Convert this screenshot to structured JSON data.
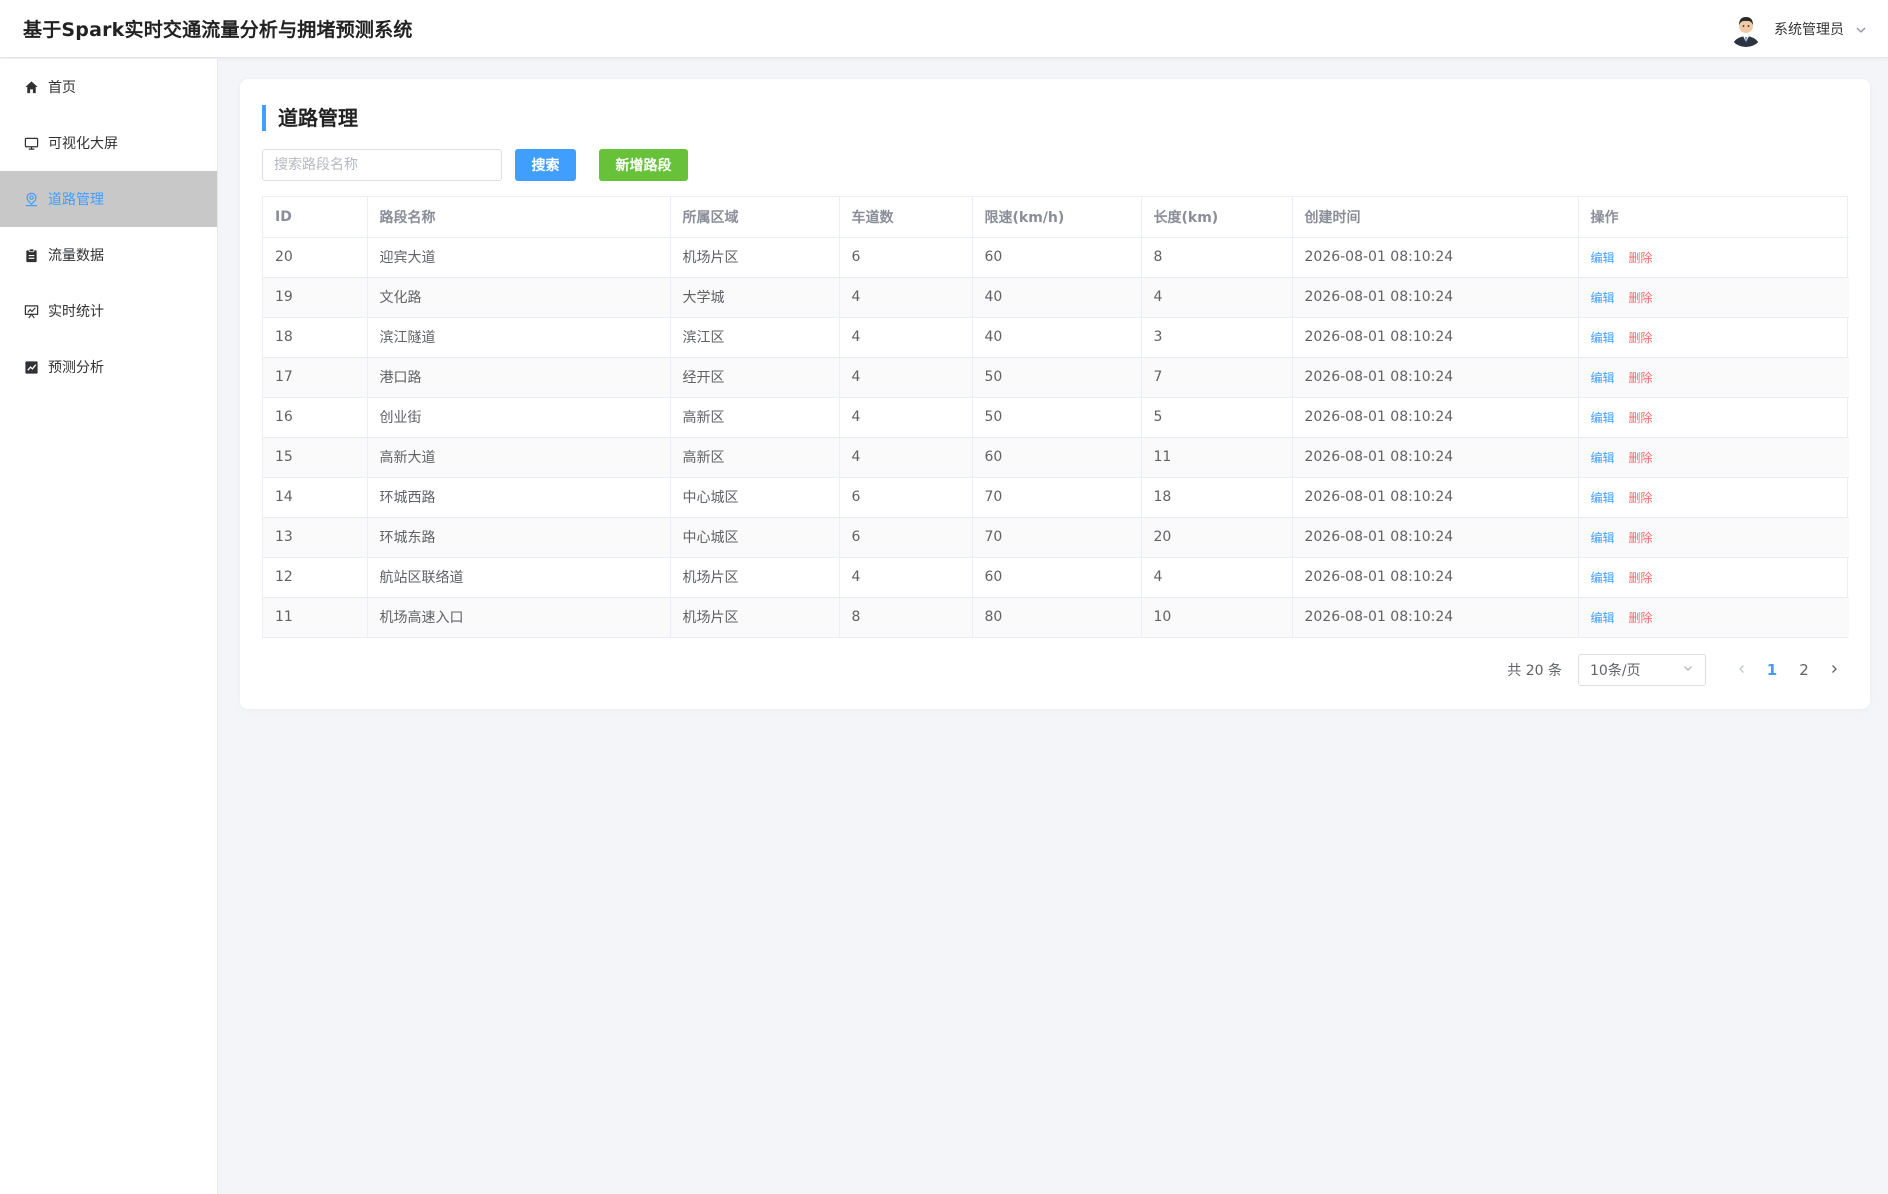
{
  "header": {
    "title": "基于Spark实时交通流量分析与拥堵预测系统",
    "user_name": "系统管理员"
  },
  "sidebar": {
    "items": [
      {
        "label": "首页",
        "icon": "home-icon"
      },
      {
        "label": "可视化大屏",
        "icon": "monitor-icon"
      },
      {
        "label": "道路管理",
        "icon": "location-icon",
        "active": true
      },
      {
        "label": "流量数据",
        "icon": "clipboard-icon"
      },
      {
        "label": "实时统计",
        "icon": "presentation-icon"
      },
      {
        "label": "预测分析",
        "icon": "trend-chart-icon"
      }
    ]
  },
  "main": {
    "title": "道路管理",
    "search_placeholder": "搜索路段名称",
    "search_button": "搜索",
    "add_button": "新增路段",
    "table": {
      "columns": [
        "ID",
        "路段名称",
        "所属区域",
        "车道数",
        "限速(km/h)",
        "长度(km)",
        "创建时间",
        "操作"
      ],
      "rows": [
        [
          "20",
          "迎宾大道",
          "机场片区",
          "6",
          "60",
          "8",
          "2026-08-01 08:10:24"
        ],
        [
          "19",
          "文化路",
          "大学城",
          "4",
          "40",
          "4",
          "2026-08-01 08:10:24"
        ],
        [
          "18",
          "滨江隧道",
          "滨江区",
          "4",
          "40",
          "3",
          "2026-08-01 08:10:24"
        ],
        [
          "17",
          "港口路",
          "经开区",
          "4",
          "50",
          "7",
          "2026-08-01 08:10:24"
        ],
        [
          "16",
          "创业街",
          "高新区",
          "4",
          "50",
          "5",
          "2026-08-01 08:10:24"
        ],
        [
          "15",
          "高新大道",
          "高新区",
          "4",
          "60",
          "11",
          "2026-08-01 08:10:24"
        ],
        [
          "14",
          "环城西路",
          "中心城区",
          "6",
          "70",
          "18",
          "2026-08-01 08:10:24"
        ],
        [
          "13",
          "环城东路",
          "中心城区",
          "6",
          "70",
          "20",
          "2026-08-01 08:10:24"
        ],
        [
          "12",
          "航站区联络道",
          "机场片区",
          "4",
          "60",
          "4",
          "2026-08-01 08:10:24"
        ],
        [
          "11",
          "机场高速入口",
          "机场片区",
          "8",
          "80",
          "10",
          "2026-08-01 08:10:24"
        ]
      ],
      "edit_label": "编辑",
      "delete_label": "删除"
    },
    "pagination": {
      "total_text": "共 20 条",
      "page_size": "10条/页",
      "pages": [
        "1",
        "2"
      ],
      "current": "1"
    }
  },
  "colors": {
    "primary": "#409eff",
    "success": "#67c23a",
    "danger": "#f56c6c"
  }
}
